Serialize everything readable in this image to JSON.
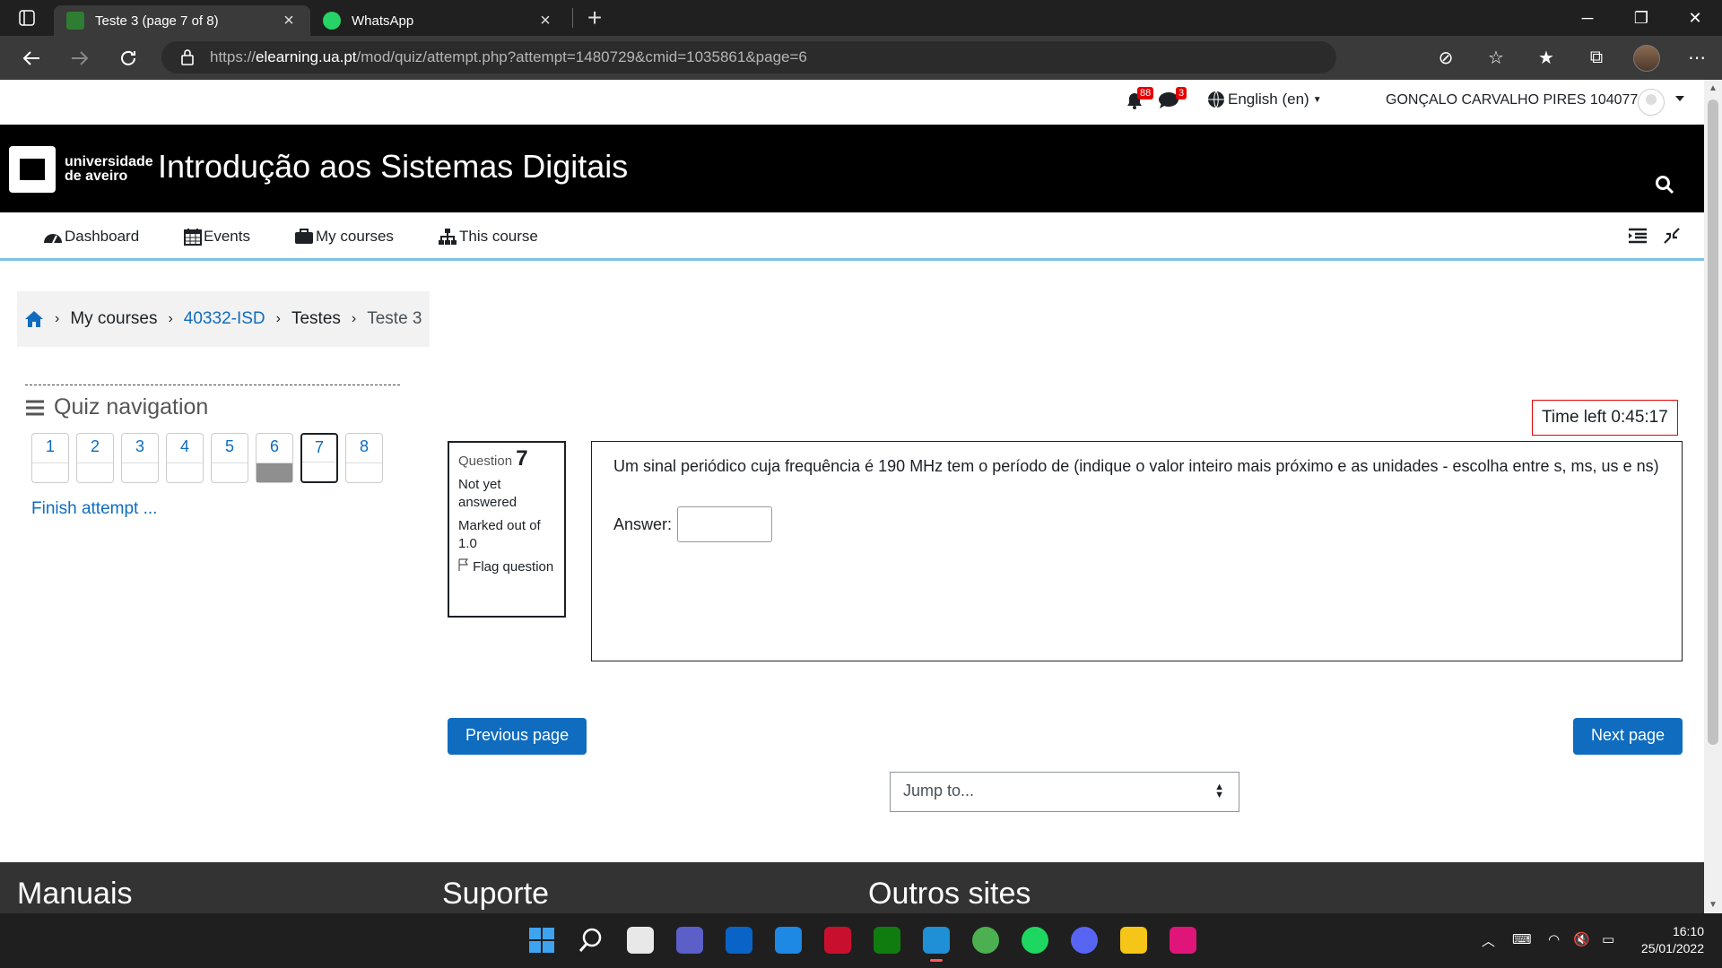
{
  "browser": {
    "tabs": [
      {
        "title": "Teste 3 (page 7 of 8)",
        "active": true
      },
      {
        "title": "WhatsApp",
        "active": false
      }
    ],
    "url_prefix": "https://",
    "url_domain": "elearning.ua.pt",
    "url_path": "/mod/quiz/attempt.php?attempt=1480729&cmid=1035861&page=6"
  },
  "userbar": {
    "notifications_count": "88",
    "messages_count": "3",
    "language": "English (en)",
    "user_name": "GONÇALO CARVALHO PIRES 104077"
  },
  "header": {
    "logo_line1": "universidade",
    "logo_line2": "de aveiro",
    "course_title": "Introdução aos Sistemas Digitais"
  },
  "nav": {
    "dashboard": "Dashboard",
    "events": "Events",
    "my_courses": "My courses",
    "this_course": "This course"
  },
  "breadcrumb": {
    "my_courses": "My courses",
    "course": "40332-ISD",
    "section": "Testes",
    "current": "Teste 3"
  },
  "quiz_nav": {
    "title": "Quiz navigation",
    "questions": [
      {
        "label": "1",
        "answered": false,
        "current": false
      },
      {
        "label": "2",
        "answered": false,
        "current": false
      },
      {
        "label": "3",
        "answered": false,
        "current": false
      },
      {
        "label": "4",
        "answered": false,
        "current": false
      },
      {
        "label": "5",
        "answered": false,
        "current": false
      },
      {
        "label": "6",
        "answered": true,
        "current": false
      },
      {
        "label": "7",
        "answered": false,
        "current": true
      },
      {
        "label": "8",
        "answered": false,
        "current": false
      }
    ],
    "finish": "Finish attempt ..."
  },
  "timer": {
    "label": "Time left 0:45:17"
  },
  "question": {
    "prefix": "Question",
    "number": "7",
    "status": "Not yet answered",
    "marks": "Marked out of 1.0",
    "flag": "Flag question",
    "text": "Um sinal periódico cuja frequência é 190 MHz tem o período de (indique o valor inteiro mais próximo e as unidades - escolha entre s, ms, us e ns)",
    "answer_label": "Answer:",
    "answer_value": ""
  },
  "buttons": {
    "previous": "Previous page",
    "next": "Next page",
    "jump": "Jump to..."
  },
  "footer": {
    "col1": "Manuais",
    "col2": "Suporte",
    "col3": "Outros sites"
  },
  "taskbar": {
    "time": "16:10",
    "date": "25/01/2022"
  }
}
